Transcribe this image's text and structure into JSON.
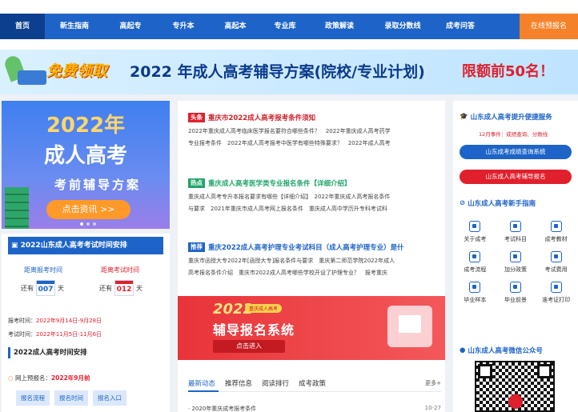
{
  "nav": {
    "items": [
      {
        "label": "首页",
        "active": true
      },
      {
        "label": "新生指南"
      },
      {
        "label": "高起专"
      },
      {
        "label": "专升本"
      },
      {
        "label": "高起本"
      },
      {
        "label": "专业库"
      },
      {
        "label": "政策解读"
      },
      {
        "label": "录取分数线"
      },
      {
        "label": "成考问答"
      }
    ],
    "cta": "在线预报名",
    "active_color": "#0d3f8f",
    "bar_color": "#1e64c8",
    "cta_color": "#f5822a"
  },
  "banner": {
    "badge": "免费领取",
    "title": "2022 年成人高考辅导方案(院校/专业计划)",
    "limit": "限额前50名！"
  },
  "promo": {
    "year": "2022年",
    "title": "成人高考",
    "subtitle": "考前辅导方案",
    "button": "点击资讯 >>"
  },
  "exam_schedule": {
    "heading": "2022山东成人高考考试时间安排",
    "countdowns": [
      {
        "label": "距离报考时间",
        "prefix": "还有",
        "days": "007",
        "suffix": "天"
      },
      {
        "label": "距离考试时间",
        "prefix": "还有",
        "days": "012",
        "suffix": "天"
      }
    ],
    "registration_label": "报考时间：",
    "registration_value": "2022年9月14日-9月28日",
    "exam_label": "考试时间：",
    "exam_value": "2022年11月5日-11月6日",
    "section_title": "2022成人高考时间安排",
    "online_label": "网上预报名：",
    "online_value": "2022年9月前",
    "chips": [
      "报名流程",
      "报名时间",
      "报名入口"
    ]
  },
  "news": [
    {
      "tag": "头条",
      "headline": "重庆市2022成人高考报考条件须知",
      "lines": [
        "2022年重庆成人高考临床医学报名要符合哪些条件？　2022年重庆成人高考药学",
        "专业报考条件　2022年成人高考报考中医学有哪些特殊要求？　2022年成人高考"
      ]
    },
    {
      "tag": "热点",
      "headline": "重庆成人高考医学类专业报名条件【详细介绍】",
      "lines": [
        "重庆成人高考专升本报名要求有哪些【详细介绍】　2022年重庆成人高考报名条件",
        "与要求　2021年重庆市成人高考网上报名条件　重庆成人高中学历升专科考试科"
      ]
    },
    {
      "tag": "推荐",
      "headline": "重庆2022成人高考护理专业考试科目（成人高考护理专业）是什",
      "lines": [
        "重庆市函授大专2022年[函授大专]报名条件与要求　重庆第二师范学院2022年成人",
        "高考报名条件介绍　重庆市2022成人高考哪些学校开设了护理专业？　报考重庆"
      ]
    }
  ],
  "system_banner": {
    "year": "2022",
    "mini": "重庆成人高考",
    "title": "辅导报名系统",
    "button": "点击进入"
  },
  "tabs": {
    "items": [
      "最新动态",
      "推荐信息",
      "阅读排行",
      "成考政策"
    ],
    "more": "更多+"
  },
  "list": [
    {
      "title": "· 2020年重庆成考报考条件",
      "date": "10-27"
    }
  ],
  "sidebar": {
    "service_title": "山东成人高考提升便捷服务",
    "service_note": "12月事件：成绩查询、分数线",
    "btn_primary": "山东成考成绩查询系统",
    "btn_secondary": "山东成人高考辅导报名",
    "guide_title": "山东成人高考新手指南",
    "guide_items": [
      {
        "label": "关于成考",
        "icon": "user-icon"
      },
      {
        "label": "考试科目",
        "icon": "book-icon"
      },
      {
        "label": "成考教材",
        "icon": "textbook-icon"
      },
      {
        "label": "成考流程",
        "icon": "flow-icon"
      },
      {
        "label": "加分政策",
        "icon": "plus-icon"
      },
      {
        "label": "考试费用",
        "icon": "fee-icon"
      },
      {
        "label": "毕业样本",
        "icon": "certificate-icon"
      },
      {
        "label": "毕业前景",
        "icon": "briefcase-icon"
      },
      {
        "label": "准考证打印",
        "icon": "print-icon"
      }
    ],
    "wechat_title": "山东成人高考微信公众号"
  }
}
